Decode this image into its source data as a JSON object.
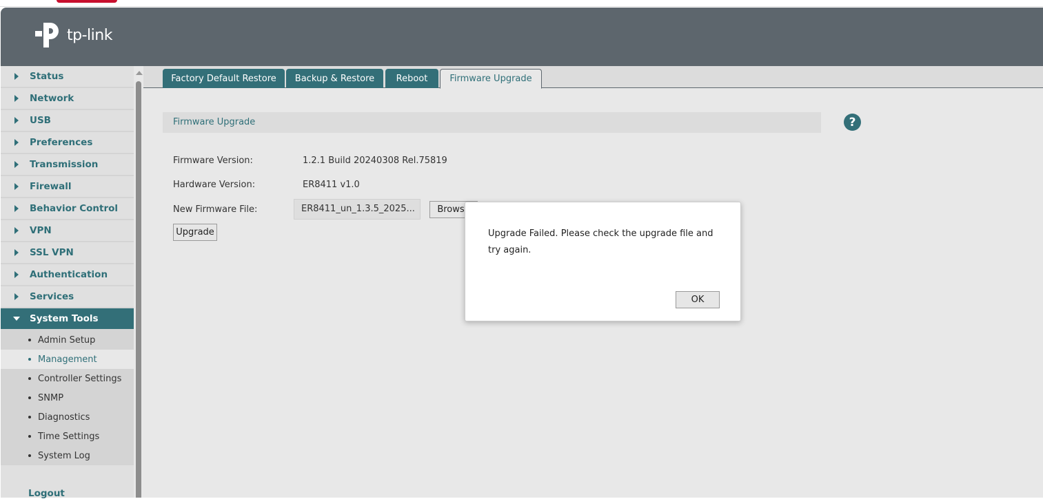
{
  "brand": {
    "name": "tp-link"
  },
  "sidebar": {
    "items": [
      {
        "label": "Status"
      },
      {
        "label": "Network"
      },
      {
        "label": "USB"
      },
      {
        "label": "Preferences"
      },
      {
        "label": "Transmission"
      },
      {
        "label": "Firewall"
      },
      {
        "label": "Behavior Control"
      },
      {
        "label": "VPN"
      },
      {
        "label": "SSL VPN"
      },
      {
        "label": "Authentication"
      },
      {
        "label": "Services"
      },
      {
        "label": "System Tools"
      }
    ],
    "sub_items": [
      {
        "label": "Admin Setup"
      },
      {
        "label": "Management"
      },
      {
        "label": "Controller Settings"
      },
      {
        "label": "SNMP"
      },
      {
        "label": "Diagnostics"
      },
      {
        "label": "Time Settings"
      },
      {
        "label": "System Log"
      }
    ],
    "logout": "Logout"
  },
  "tabs": [
    {
      "label": "Factory Default Restore"
    },
    {
      "label": "Backup & Restore"
    },
    {
      "label": "Reboot"
    },
    {
      "label": "Firmware Upgrade"
    }
  ],
  "section": {
    "title": "Firmware Upgrade",
    "help_icon": "?"
  },
  "form": {
    "firmware_label": "Firmware Version:",
    "firmware_value": "1.2.1 Build 20240308 Rel.75819",
    "hardware_label": "Hardware Version:",
    "hardware_value": "ER8411 v1.0",
    "file_label": "New Firmware File:",
    "file_value": "ER8411_un_1.3.5_2025...",
    "browse": "Browse",
    "upgrade": "Upgrade"
  },
  "dialog": {
    "message": "Upgrade Failed. Please check the upgrade file and try again.",
    "ok": "OK"
  },
  "colors": {
    "accent": "#336f78",
    "header": "#5d666d"
  }
}
